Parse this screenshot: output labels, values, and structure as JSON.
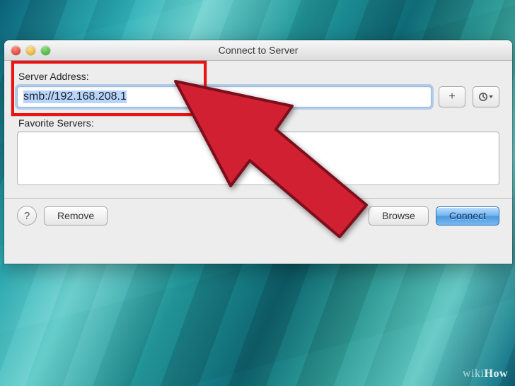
{
  "titlebar": {
    "title": "Connect to Server"
  },
  "labels": {
    "server_address": "Server Address:",
    "favorite_servers": "Favorite Servers:"
  },
  "address": {
    "value": "smb://192.168.208.1"
  },
  "buttons": {
    "add": "+",
    "help": "?",
    "remove": "Remove",
    "browse": "Browse",
    "connect": "Connect"
  },
  "watermark": {
    "prefix": "wiki",
    "suffix": "How"
  },
  "annotation": {
    "highlight_color": "#ee1111",
    "arrow_color": "#d22033"
  }
}
